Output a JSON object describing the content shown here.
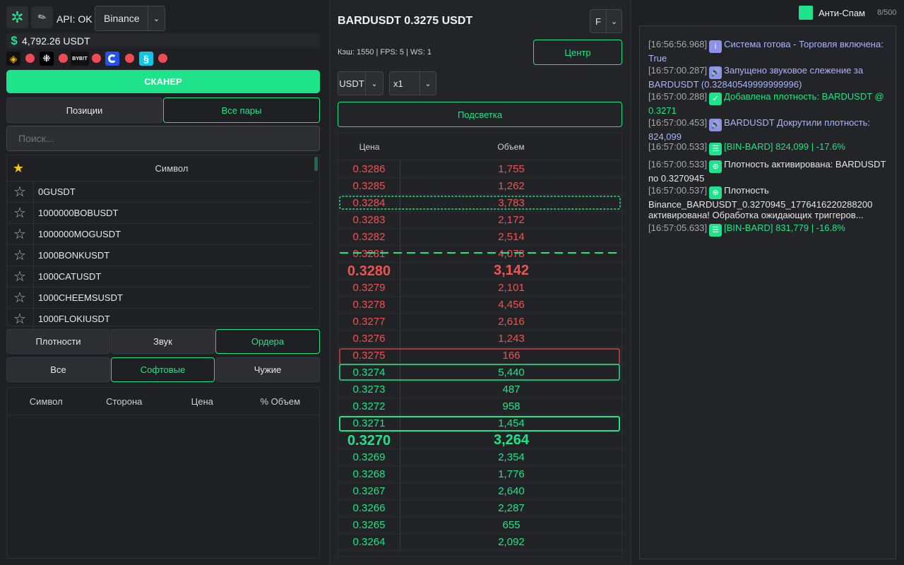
{
  "header": {
    "api_status": "API: OK",
    "exchange": "Binance",
    "balance": "4,792.26 USDT",
    "scanner_button": "СКАНЕР"
  },
  "exchange_icons": [
    {
      "name": "binance-icon",
      "status_color": "#ef4b57"
    },
    {
      "name": "okx-icon",
      "status_color": "#ef4b57"
    },
    {
      "name": "bybit-icon",
      "label": "BYB!T",
      "status_color": "#ef4b57"
    },
    {
      "name": "gate-icon",
      "status_color": "#ef4b57"
    },
    {
      "name": "bitget-icon",
      "status_color": "#ef4b57"
    }
  ],
  "tabs": {
    "positions": "Позиции",
    "all_pairs": "Все пары"
  },
  "search": {
    "placeholder": "Поиск..."
  },
  "symbols": {
    "header": "Символ",
    "items": [
      "0GUSDT",
      "1000000BOBUSDT",
      "1000000MOGUSDT",
      "1000BONKUSDT",
      "1000CATUSDT",
      "1000CHEEMSUSDT",
      "1000FLOKIUSDT"
    ]
  },
  "filters": {
    "densities": "Плотности",
    "sound": "Звук",
    "orders": "Ордера",
    "all": "Все",
    "soft": "Софтовые",
    "foreign": "Чужие"
  },
  "orders_table": {
    "columns": [
      "Символ",
      "Сторона",
      "Цена",
      "% Объем"
    ]
  },
  "orderbook": {
    "title": "BARDUSDT 0.3275 USDT",
    "type": "F",
    "stats": "Кэш: 1550 | FPS: 5 | WS: 1",
    "center_button": "Центр",
    "currency": "USDT",
    "multiplier": "x1",
    "highlight_button": "Подсветка",
    "col_price": "Цена",
    "col_volume": "Объем",
    "rows": [
      {
        "price": "0.3286",
        "volume": "1,755",
        "side": "ask"
      },
      {
        "price": "0.3285",
        "volume": "1,262",
        "side": "ask"
      },
      {
        "price": "0.3284",
        "volume": "3,783",
        "side": "ask",
        "mark": "wavy"
      },
      {
        "price": "0.3283",
        "volume": "2,172",
        "side": "ask"
      },
      {
        "price": "0.3282",
        "volume": "2,514",
        "side": "ask"
      },
      {
        "price": "0.3281",
        "volume": "4,078",
        "side": "ask",
        "mark": "dashed"
      },
      {
        "price": "0.3280",
        "volume": "3,142",
        "side": "ask",
        "big": true
      },
      {
        "price": "0.3279",
        "volume": "2,101",
        "side": "ask"
      },
      {
        "price": "0.3278",
        "volume": "4,456",
        "side": "ask"
      },
      {
        "price": "0.3277",
        "volume": "2,616",
        "side": "ask"
      },
      {
        "price": "0.3276",
        "volume": "1,243",
        "side": "ask"
      },
      {
        "price": "0.3275",
        "volume": "166",
        "side": "ask",
        "mark": "spread"
      },
      {
        "price": "0.3274",
        "volume": "5,440",
        "side": "bid",
        "mark": "spread"
      },
      {
        "price": "0.3273",
        "volume": "487",
        "side": "bid"
      },
      {
        "price": "0.3272",
        "volume": "958",
        "side": "bid"
      },
      {
        "price": "0.3271",
        "volume": "1,454",
        "side": "bid",
        "mark": "box"
      },
      {
        "price": "0.3270",
        "volume": "3,264",
        "side": "bid",
        "big": true
      },
      {
        "price": "0.3269",
        "volume": "2,354",
        "side": "bid"
      },
      {
        "price": "0.3268",
        "volume": "1,776",
        "side": "bid"
      },
      {
        "price": "0.3267",
        "volume": "2,640",
        "side": "bid"
      },
      {
        "price": "0.3266",
        "volume": "2,287",
        "side": "bid"
      },
      {
        "price": "0.3265",
        "volume": "655",
        "side": "bid"
      },
      {
        "price": "0.3264",
        "volume": "2,092",
        "side": "bid"
      }
    ]
  },
  "right_panel": {
    "antispam_label": "Анти-Спам",
    "counter": "8/500"
  },
  "log": [
    {
      "time": "[16:56:56.968]",
      "icon": "info-icon",
      "color": "#a9b4ff",
      "text": "Система готова - Торговля включена: True"
    },
    {
      "time": "[16:57:00.287]",
      "icon": "speaker-icon",
      "color": "#a9b4ff",
      "text": "Запущено звуковое слежение за BARDUSDT (0.32840549999999996)"
    },
    {
      "time": "[16:57:00.288]",
      "icon": "check-icon",
      "color": "#1ee38a",
      "text": "Добавлена плотность: BARDUSDT @ 0.3271"
    },
    {
      "time": "[16:57:00.453]",
      "icon": "speaker-icon",
      "color": "#a9b4ff",
      "text": "BARDUSDT Докрутили плотность: 824,099"
    },
    {
      "time": "[16:57:00.533]",
      "icon": "list-icon",
      "color": "#1ee38a",
      "text": "[BIN-BARD] 824,099 | -17.6%"
    },
    {
      "time": "[16:57:00.533]",
      "icon": "target-icon",
      "color": "#e6e6e6",
      "text": "Плотность активирована: BARDUSDT по 0.3270945"
    },
    {
      "time": "[16:57:00.537]",
      "icon": "target-icon",
      "color": "#e6e6e6",
      "text": "Плотность Binance_BARDUSDT_0.3270945_1776416220288200 активирована! Обработка ожидающих триггеров..."
    },
    {
      "time": "[16:57:05.633]",
      "icon": "list-icon",
      "color": "#1ee38a",
      "text": "[BIN-BARD] 831,779 | -16.8%"
    }
  ]
}
